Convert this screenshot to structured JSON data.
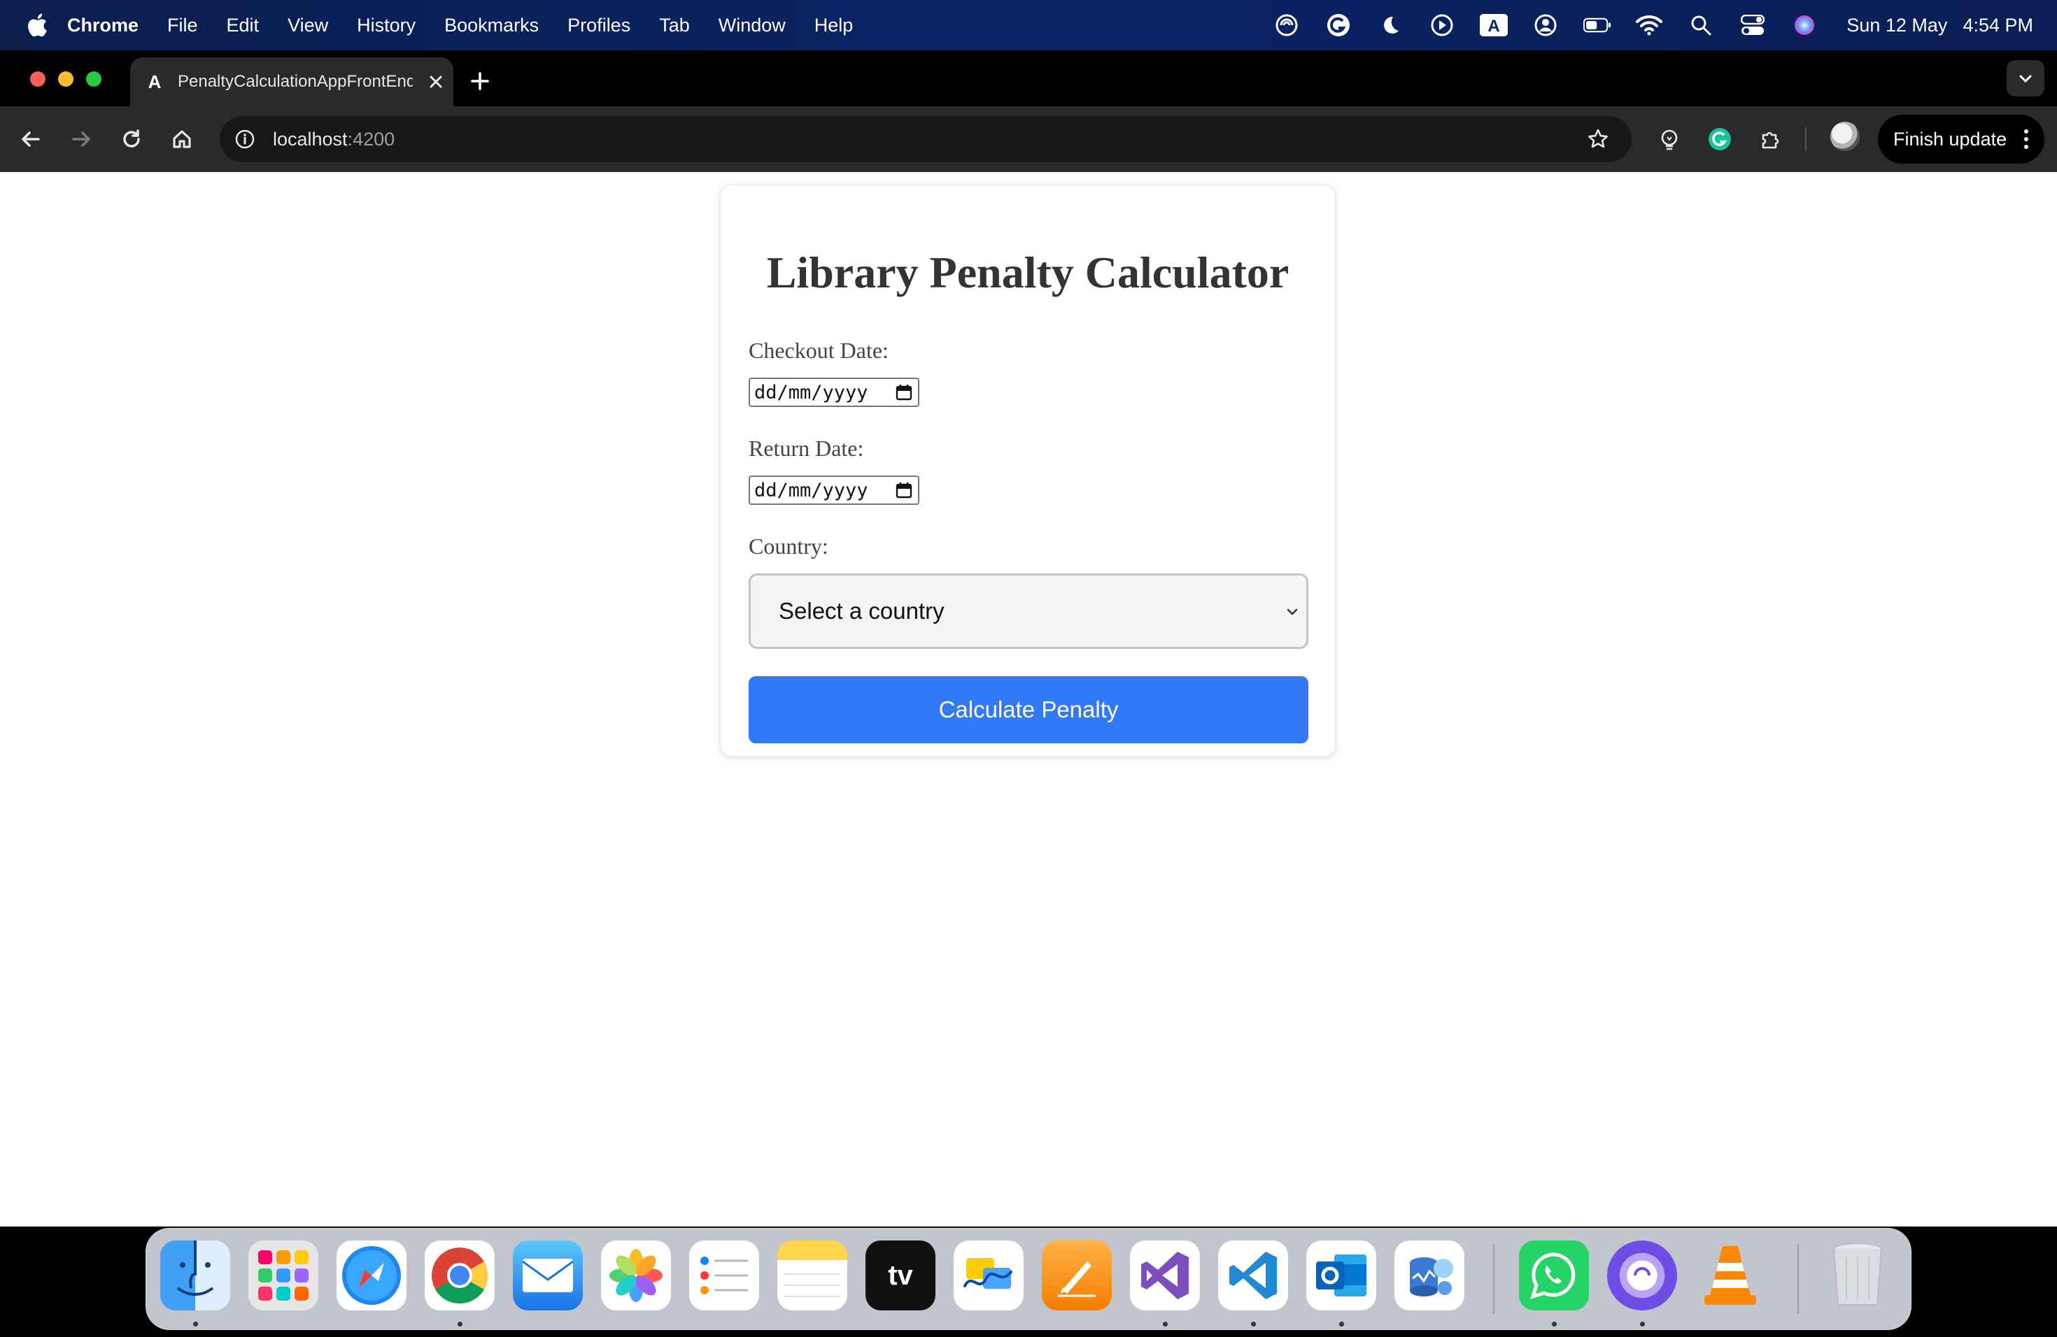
{
  "menubar": {
    "items": [
      "Chrome",
      "File",
      "Edit",
      "View",
      "History",
      "Bookmarks",
      "Profiles",
      "Tab",
      "Window",
      "Help"
    ],
    "date": "Sun 12 May",
    "time": "4:54 PM",
    "status_icons": [
      "siri-like-icon",
      "grammarly-icon",
      "moon-icon",
      "play-icon",
      "input-source-icon",
      "user-icon",
      "battery-icon",
      "wifi-icon",
      "search-icon",
      "control-center-icon",
      "siri-icon"
    ],
    "input_source_label": "A"
  },
  "browser": {
    "tab_title": "PenaltyCalculationAppFrontEnd",
    "favicon_letter": "A",
    "url_host": "localhost",
    "url_port": ":4200",
    "finish_update_label": "Finish update"
  },
  "page": {
    "title": "Library Penalty Calculator",
    "checkout_label": "Checkout Date:",
    "checkout_placeholder": "dd/mm/yyyy",
    "return_label": "Return Date:",
    "return_placeholder": "dd/mm/yyyy",
    "country_label": "Country:",
    "country_selected": "Select a country",
    "calculate_label": "Calculate Penalty"
  },
  "dock": {
    "apps": [
      "finder",
      "launchpad",
      "safari",
      "chrome",
      "mail",
      "photos",
      "reminders",
      "notes",
      "apple-tv",
      "freeform",
      "pages",
      "visual-studio",
      "vscode",
      "outlook",
      "azure-data-studio",
      "whatsapp",
      "bittorrent",
      "vlc",
      "trash"
    ],
    "tv_label": "tv"
  },
  "colors": {
    "accent_button": "#3179f7",
    "menubar": "#0a2466"
  }
}
